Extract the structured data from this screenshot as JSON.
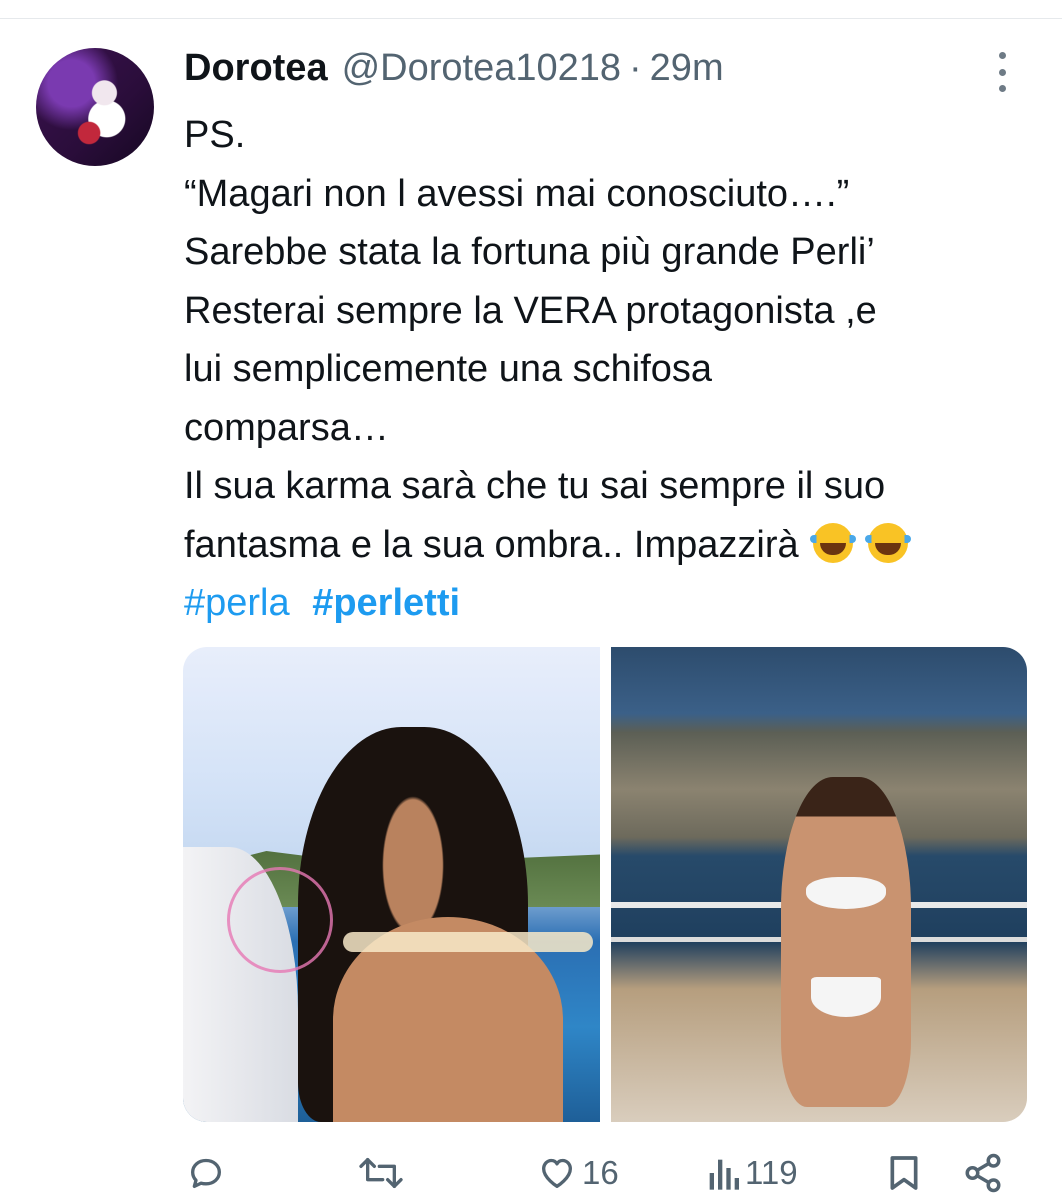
{
  "tweet": {
    "author_name": "Dorotea",
    "author_handle": "@Dorotea10218",
    "separator": "·",
    "time": "29m",
    "lines": [
      "PS.",
      "“Magari non l avessi mai conosciuto….”",
      "Sarebbe stata la fortuna più grande Perli’",
      "Resterai sempre la VERA protagonista ,e",
      "lui semplicemente una schifosa",
      "comparsa…",
      "Il sua karma sarà che tu sai sempre il suo",
      "fantasma e la sua ombra.. Impazzirà"
    ],
    "emoji": [
      "face-with-tears-of-joy",
      "face-with-tears-of-joy"
    ],
    "hashtags": [
      "#perla",
      "#perletti"
    ]
  },
  "actions": {
    "reply_count": "",
    "retweet_count": "",
    "like_count": "16",
    "view_count": "119"
  },
  "colors": {
    "text": "#0f1419",
    "secondary": "#536471",
    "link": "#1d9bf0"
  }
}
